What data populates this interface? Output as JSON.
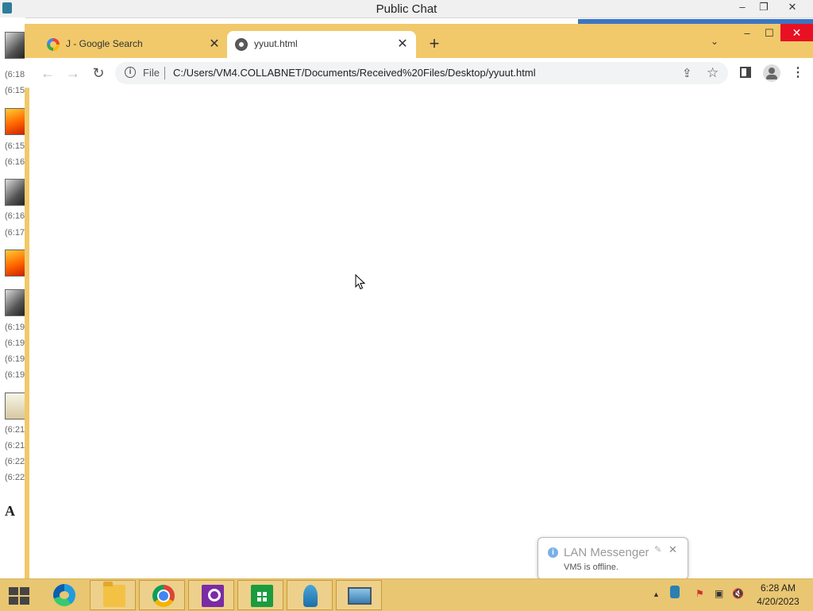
{
  "background_window": {
    "title": "Public Chat",
    "controls": {
      "minimize": "–",
      "restore": "❐",
      "close": "✕"
    },
    "timestamps": [
      "(6:18",
      "(6:15",
      "(6:15",
      "(6:16",
      "(6:16",
      "(6:17",
      "(6:19",
      "(6:19",
      "(6:19",
      "(6:19",
      "(6:21",
      "(6:21",
      "(6:22",
      "(6:22"
    ],
    "font_button": "A"
  },
  "browser": {
    "tabs": [
      {
        "label": "J - Google Search",
        "icon": "google-icon",
        "active": false
      },
      {
        "label": "yyuut.html",
        "icon": "globe-icon",
        "active": true
      }
    ],
    "new_tab": "+",
    "tab_list": "⌄",
    "window_controls": {
      "minimize": "–",
      "maximize": "☐",
      "close": "✕"
    },
    "toolbar": {
      "back": "←",
      "forward": "→",
      "reload": "↻",
      "scheme_chip": "File",
      "url": "C:/Users/VM4.COLLABNET/Documents/Received%20Files/Desktop/yyuut.html",
      "share": "⇪",
      "star": "☆",
      "menu": "⋮"
    }
  },
  "notification": {
    "title": "LAN Messenger",
    "message": "VM5 is offline.",
    "close": "✕"
  },
  "taskbar": {
    "pinned": [
      "start-button",
      "edge-icon",
      "file-explorer-icon",
      "chrome-icon",
      "search-app-icon",
      "store-icon",
      "lan-messenger-icon",
      "remote-desktop-icon"
    ],
    "tray": {
      "overflow": "▲"
    },
    "clock": {
      "time": "6:28 AM",
      "date": "4/20/2023"
    }
  }
}
